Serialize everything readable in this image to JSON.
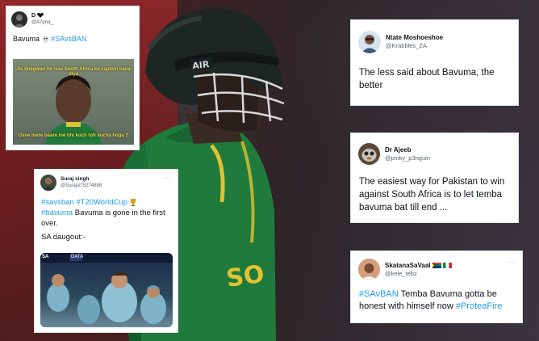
{
  "tweets": {
    "t1": {
      "name": "D",
      "handle": "@A7pha_",
      "text_parts": [
        "Bavuma",
        "#SAvsBAN"
      ],
      "meme_top": "Jis bhagwan ne isse South Africa ka captain bana diya",
      "meme_bottom": "Usne mere baare me bhi kuch toh socha hoga !!"
    },
    "t2": {
      "name": "Suraj singh",
      "handle": "@Surajsi75274888",
      "line1_tags": [
        "#savsban",
        "#T20WorldCup"
      ],
      "line2_tag": "#bavuma",
      "line2_text": " Bavuma is gone in the first over.",
      "line3": "SA daugout:-",
      "scoreboard_left": "SA",
      "scoreboard_right": "DATA"
    },
    "t3": {
      "name": "Ntate Moshoeshoe",
      "handle": "@Krabbles_ZA",
      "text": "The less said about Bavuma, the better"
    },
    "t4": {
      "name": "Dr Ajeeb",
      "handle": "@pinky_p3nguin",
      "text": "The easiest way for Pakistan to win against South Africa is to let temba bavuma bat till end ..."
    },
    "t5": {
      "name": "SkatanaSaVaal",
      "handle": "@kele_tebz",
      "tag1": "#SAvBAN",
      "text": " Temba Bavuma gotta be honest with himself now ",
      "tag2": "#ProteaFire"
    }
  },
  "helmet_text": "AIR",
  "jersey_text": "SO",
  "more_glyph": "···",
  "colors": {
    "link": "#1d9bf0",
    "jersey": "#1f7a3b",
    "helmet": "#1d2623"
  }
}
